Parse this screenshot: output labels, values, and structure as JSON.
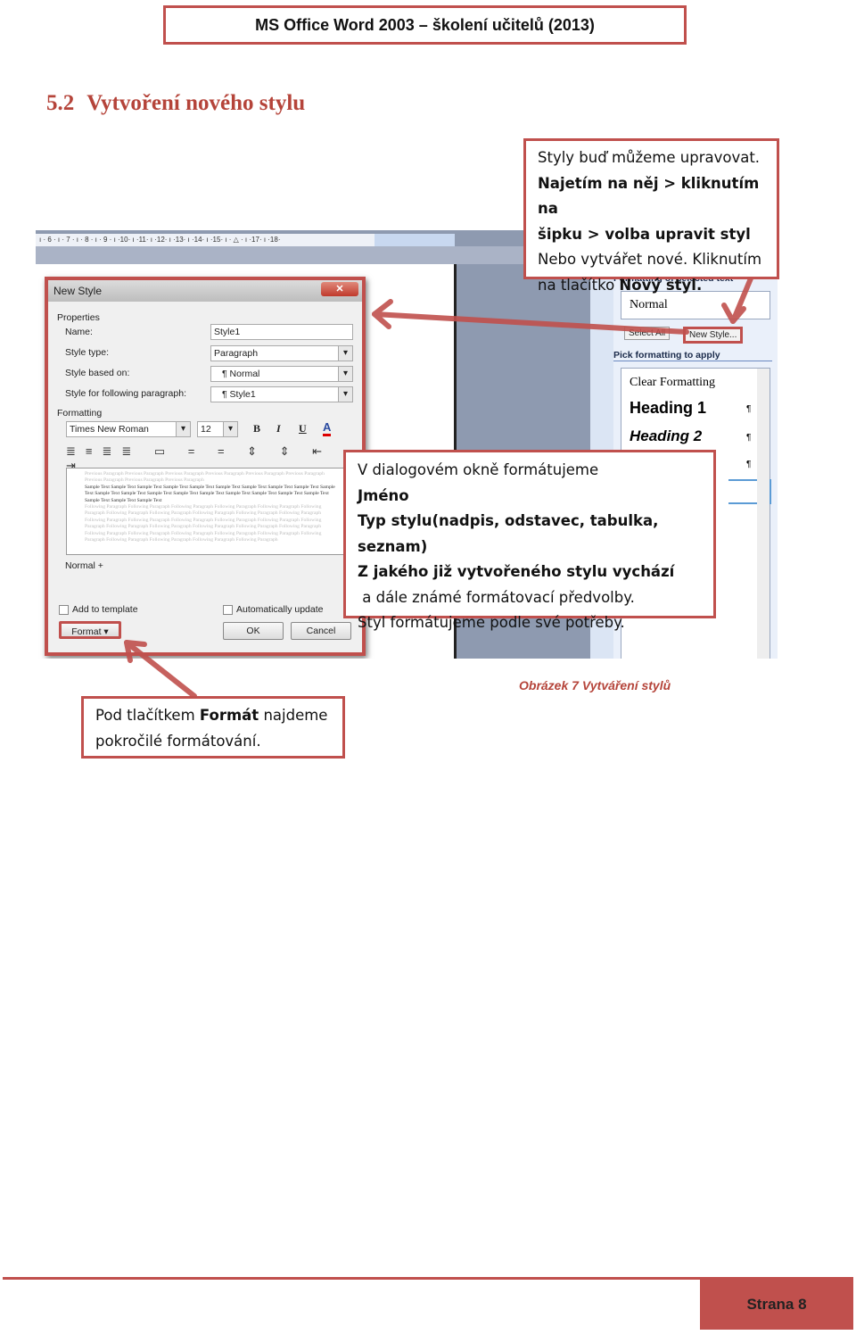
{
  "header": {
    "title": "MS Office Word 2003 – školení učitelů (2013)"
  },
  "section": {
    "number": "5.2",
    "title": "Vytvoření nového stylu"
  },
  "screenshot": {
    "ruler": "ı · 6 · ı · 7 · ı · 8 · ı · 9 · ı ·10· ı ·11· ı ·12· ı ·13· ı ·14· ı ·15· ı · △ · ı ·17· ı ·18·",
    "dialog": {
      "title": "New Style",
      "close": "✕",
      "properties_label": "Properties",
      "name_label": "Name:",
      "name_value": "Style1",
      "style_type_label": "Style type:",
      "style_type_value": "Paragraph",
      "based_on_label": "Style based on:",
      "based_on_value": "¶ Normal",
      "following_label": "Style for following paragraph:",
      "following_value": "¶ Style1",
      "formatting_label": "Formatting",
      "font": "Times New Roman",
      "size": "12",
      "bold": "B",
      "italic": "I",
      "underline": "U",
      "font_color": "A",
      "preview_previous": "Previous Paragraph Previous Paragraph Previous Paragraph Previous Paragraph Previous Paragraph Previous Paragraph Previous Paragraph Previous Paragraph Previous Paragraph",
      "preview_sample": "Sample Text Sample Text Sample Text Sample Text Sample Text Sample Text Sample Text Sample Text Sample Text Sample Text Sample Text Sample Text Sample Text Sample Text Sample Text Sample Text Sample Text Sample Text Sample Text Sample Text Sample Text Sample Text",
      "preview_following": "Following Paragraph Following Paragraph Following Paragraph Following Paragraph Following Paragraph Following Paragraph Following Paragraph Following Paragraph Following Paragraph Following Paragraph Following Paragraph Following Paragraph Following Paragraph Following Paragraph Following Paragraph Following Paragraph Following Paragraph Following Paragraph Following Paragraph Following Paragraph Following Paragraph Following Paragraph Following Paragraph Following Paragraph Following Paragraph Following Paragraph Following Paragraph Following Paragraph Following Paragraph Following Paragraph Following Paragraph Following Paragraph",
      "description": "Normal +",
      "add_to_template": "Add to template",
      "auto_update": "Automatically update",
      "format_button": "Format ▾",
      "ok_button": "OK",
      "cancel_button": "Cancel"
    },
    "task_pane": {
      "formatting_selected": "Formatting of selected text",
      "current": "Normal",
      "select_all": "Select All",
      "new_style": "New Style...",
      "pick_label": "Pick formatting to apply",
      "styles": [
        {
          "label": "Clear Formatting",
          "mark": ""
        },
        {
          "label": "Heading 1",
          "mark": "¶"
        },
        {
          "label": "Heading 2",
          "mark": "¶"
        },
        {
          "label": "",
          "mark": "¶"
        },
        {
          "label": "",
          "mark": "¶"
        }
      ]
    }
  },
  "callouts": {
    "top": {
      "l1": "Styly buď můžeme upravovat.",
      "l2": "Najetím na něj > kliknutím na",
      "l3": "šipku > volba upravit styl",
      "l4": "Nebo vytvářet nové. Kliknutím",
      "l5a": "na tlačítko ",
      "l5b": "Nový styl."
    },
    "middle": {
      "l1": "V dialogovém okně formátujeme",
      "l2": "Jméno",
      "l3": "Typ stylu(nadpis, odstavec, tabulka, seznam)",
      "l4": "Z jakého již vytvořeného stylu vychází",
      "l5": " a dále známé formátovací předvolby.",
      "l6": "Styl formátujeme podle své potřeby."
    },
    "bottom": {
      "l1a": "Pod tlačítkem ",
      "l1b": "Formát",
      "l1c": " najdeme",
      "l2": "pokročilé formátování."
    }
  },
  "caption": "Obrázek 7 Vytváření stylů",
  "footer": {
    "page": "Strana 8"
  },
  "colors": {
    "accent": "#c0504d"
  }
}
